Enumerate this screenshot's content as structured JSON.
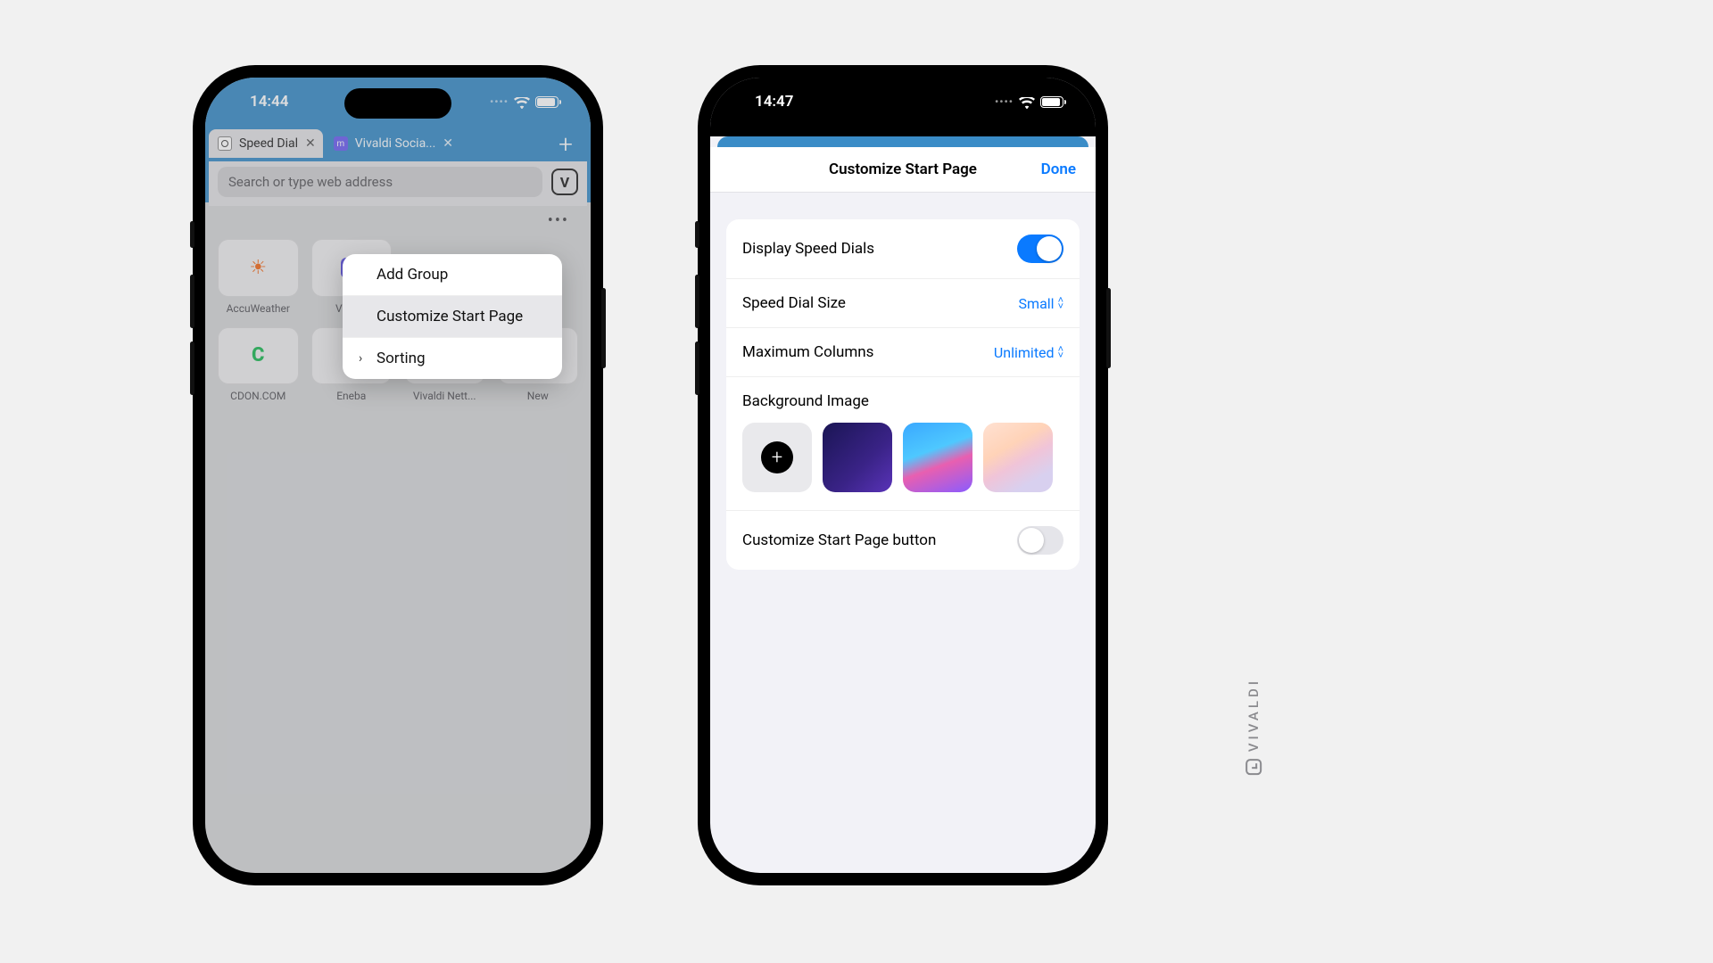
{
  "left": {
    "status": {
      "time": "14:44"
    },
    "tabs": [
      {
        "label": "Speed Dial",
        "active": true
      },
      {
        "label": "Vivaldi Socia...",
        "active": false
      }
    ],
    "address_placeholder": "Search or type web address",
    "speed_dials": [
      {
        "label": "AccuWeather"
      },
      {
        "label": "Vivaldi"
      },
      {
        "label": "CDON.COM"
      },
      {
        "label": "Eneba"
      },
      {
        "label": "Vivaldi Nett..."
      },
      {
        "label": "New"
      }
    ],
    "context_menu": {
      "items": [
        {
          "label": "Add Group"
        },
        {
          "label": "Customize Start Page"
        },
        {
          "label": "Sorting"
        }
      ]
    }
  },
  "right": {
    "status": {
      "time": "14:47"
    },
    "sheet_title": "Customize Start Page",
    "done": "Done",
    "settings": {
      "display_sd_label": "Display Speed Dials",
      "display_sd_on": true,
      "size_label": "Speed Dial Size",
      "size_value": "Small",
      "cols_label": "Maximum Columns",
      "cols_value": "Unlimited",
      "bg_label": "Background Image",
      "btn_label": "Customize Start Page button",
      "btn_on": false
    }
  },
  "watermark": "VIVALDI"
}
